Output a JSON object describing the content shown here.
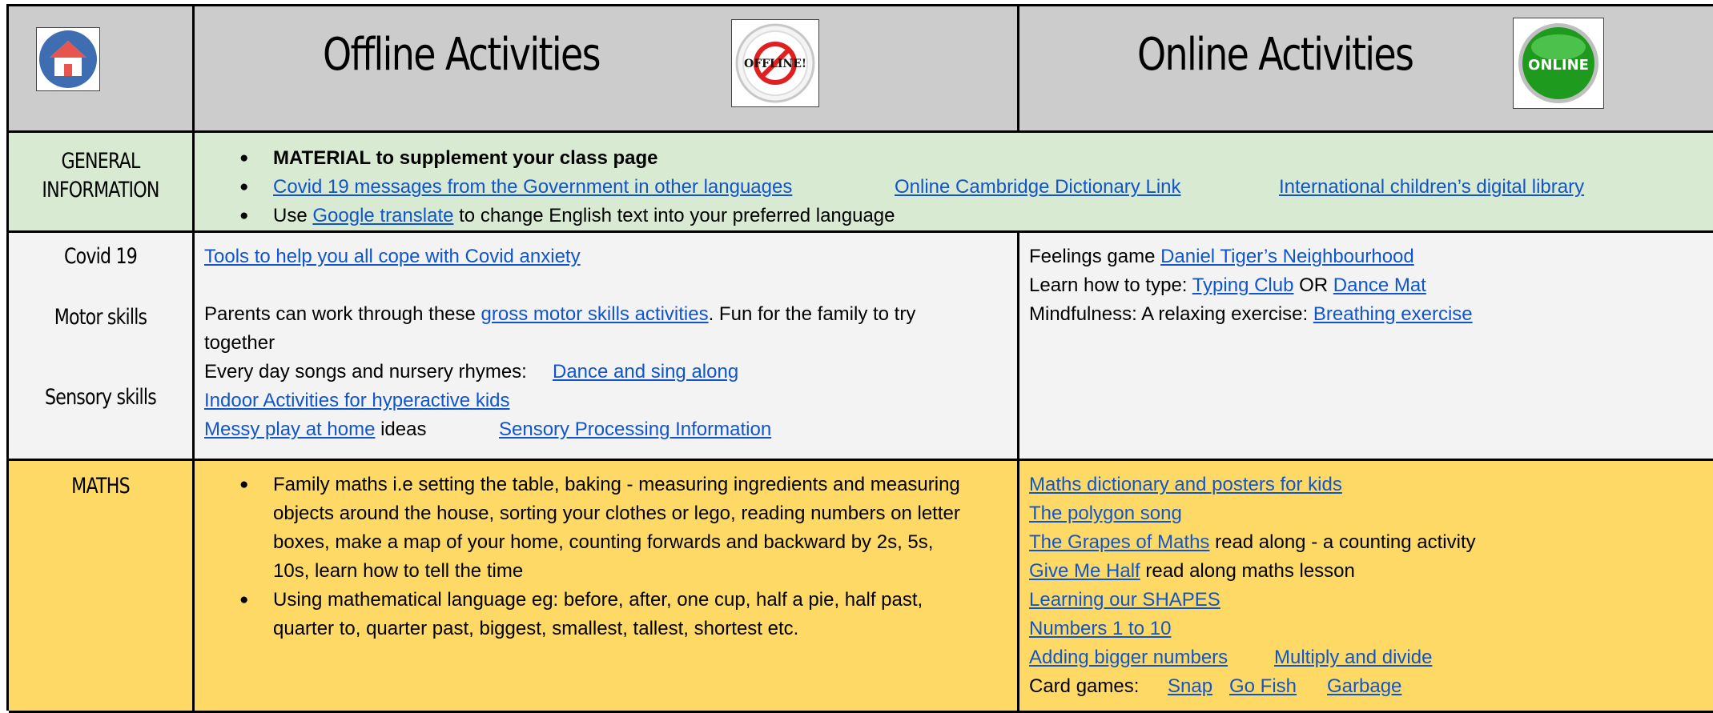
{
  "header": {
    "offline_title": "Offline Activities",
    "online_title": "Online Activities",
    "offline_badge_text": "OFFLINE!",
    "online_badge_text": "ONLINE"
  },
  "general": {
    "label_line1": "GENERAL",
    "label_line2": "INFORMATION",
    "bullet1": "MATERIAL to supplement your class page",
    "bullet2_link1": "Covid 19 messages from the Government in other languages",
    "bullet2_link2": "Online Cambridge Dictionary Link",
    "bullet2_link3": "International children’s digital library",
    "bullet3_pre": "Use ",
    "bullet3_link": "Google translate",
    "bullet3_post": " to change English text into your preferred language"
  },
  "covid": {
    "label_covid": "Covid 19",
    "label_motor": "Motor skills",
    "label_sensory": "Sensory skills",
    "offline": {
      "anxiety_link": "Tools to help you all cope with Covid anxiety",
      "motor_pre": "Parents can work through these ",
      "motor_link": "gross motor skills activities",
      "motor_post": ". Fun for the family to try",
      "motor_line2": "together",
      "songs_text": "Every day songs and nursery rhymes:",
      "songs_link": "Dance and sing along",
      "indoor_link": "Indoor Activities for hyperactive kids",
      "messy_link": "Messy play at home",
      "messy_post": " ideas",
      "sensory_link": "Sensory Processing Information"
    },
    "online": {
      "feelings_text": "Feelings game ",
      "feelings_link": "Daniel Tiger’s Neighbourhood",
      "type_text": "Learn how to type: ",
      "type_link1": "Typing Club",
      "type_or": " OR ",
      "type_link2": "Dance Mat",
      "mind_text": "Mindfulness: A relaxing exercise: ",
      "mind_link": "Breathing exercise"
    }
  },
  "maths": {
    "label": "MATHS",
    "offline_bullet1": "Family maths i.e setting the table, baking - measuring ingredients and measuring objects around the house, sorting your clothes or lego, reading numbers on letter boxes, make a map of your home, counting forwards and backward by 2s, 5s, 10s, learn how to tell the time",
    "offline_bullet2": "Using mathematical language eg: before, after, one cup, half a pie, half past, quarter to, quarter past, biggest, smallest, tallest, shortest etc.",
    "online": {
      "dict_link": "Maths dictionary and posters for kids",
      "polygon_link": "The polygon song",
      "grapes_link": "The Grapes of Maths",
      "grapes_post": " read along - a counting activity",
      "half_link": "Give Me Half",
      "half_post": " read along maths lesson",
      "shapes_link": "Learning our SHAPES",
      "numbers_link": "Numbers 1 to 10",
      "adding_link": "Adding bigger numbers",
      "multiply_link": "Multiply and divide",
      "card_text": "Card games:",
      "snap_link": "Snap",
      "gofish_link": "Go Fish",
      "garbage_link": "Garbage"
    }
  },
  "colors": {
    "header_bg": "#cccccc",
    "general_bg": "#d9ead3",
    "covid_bg": "#f3f3f3",
    "maths_bg": "#ffd966",
    "link": "#1155cc"
  }
}
